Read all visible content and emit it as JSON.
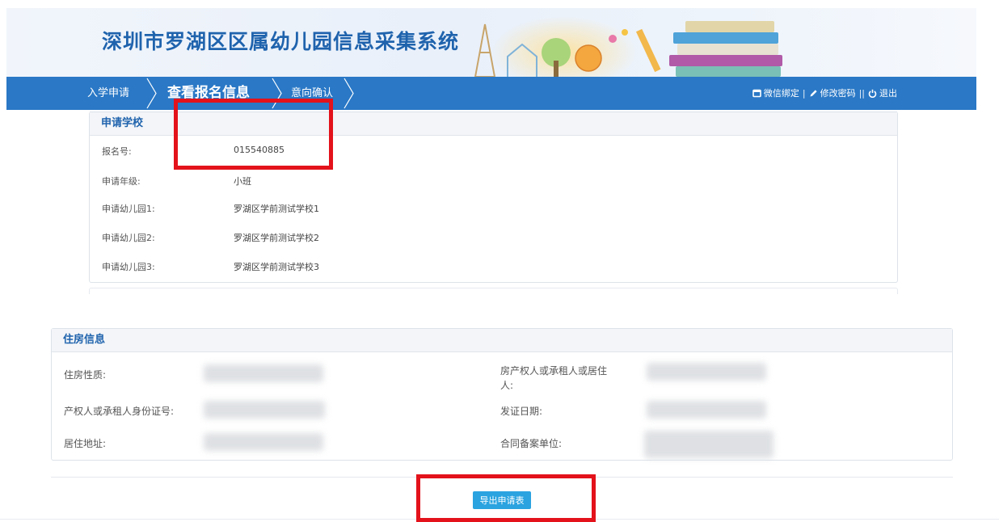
{
  "header": {
    "title": "深圳市罗湖区区属幼儿园信息采集系统"
  },
  "nav": {
    "steps": [
      {
        "label": "入学申请",
        "active": false
      },
      {
        "label": "查看报名信息",
        "active": true
      },
      {
        "label": "意向确认",
        "active": false
      }
    ],
    "right_links": {
      "wechat_bind": "微信绑定",
      "change_password": "修改密码",
      "logout": "退出",
      "sep_single": "|",
      "sep_double": "||"
    }
  },
  "school_panel": {
    "title": "申请学校",
    "rows": [
      {
        "label": "报名号:",
        "value": "015540885"
      },
      {
        "label": "申请年级:",
        "value": "小班"
      },
      {
        "label": "申请幼儿园1:",
        "value": "罗湖区学前测试学校1"
      },
      {
        "label": "申请幼儿园2:",
        "value": "罗湖区学前测试学校2"
      },
      {
        "label": "申请幼儿园3:",
        "value": "罗湖区学前测试学校3"
      }
    ]
  },
  "housing_panel": {
    "title": "住房信息",
    "labels": {
      "housing_type": "住房性质:",
      "owner_id": "产权人或承租人身份证号:",
      "address": "居住地址:",
      "owner_line1": "房产权人或承租人或居住",
      "owner_line2": "人:",
      "issue_date": "发证日期:",
      "contract_unit": "合同备案单位:"
    }
  },
  "actions": {
    "export_label": "导出申请表"
  },
  "colors": {
    "brand_blue": "#2a78c6",
    "title_blue": "#1f63ad",
    "button_blue": "#2aa3e0",
    "annotation_red": "#e3121b"
  },
  "icons": {
    "wechat": "square-icon",
    "password": "pencil-icon",
    "logout": "power-icon"
  }
}
